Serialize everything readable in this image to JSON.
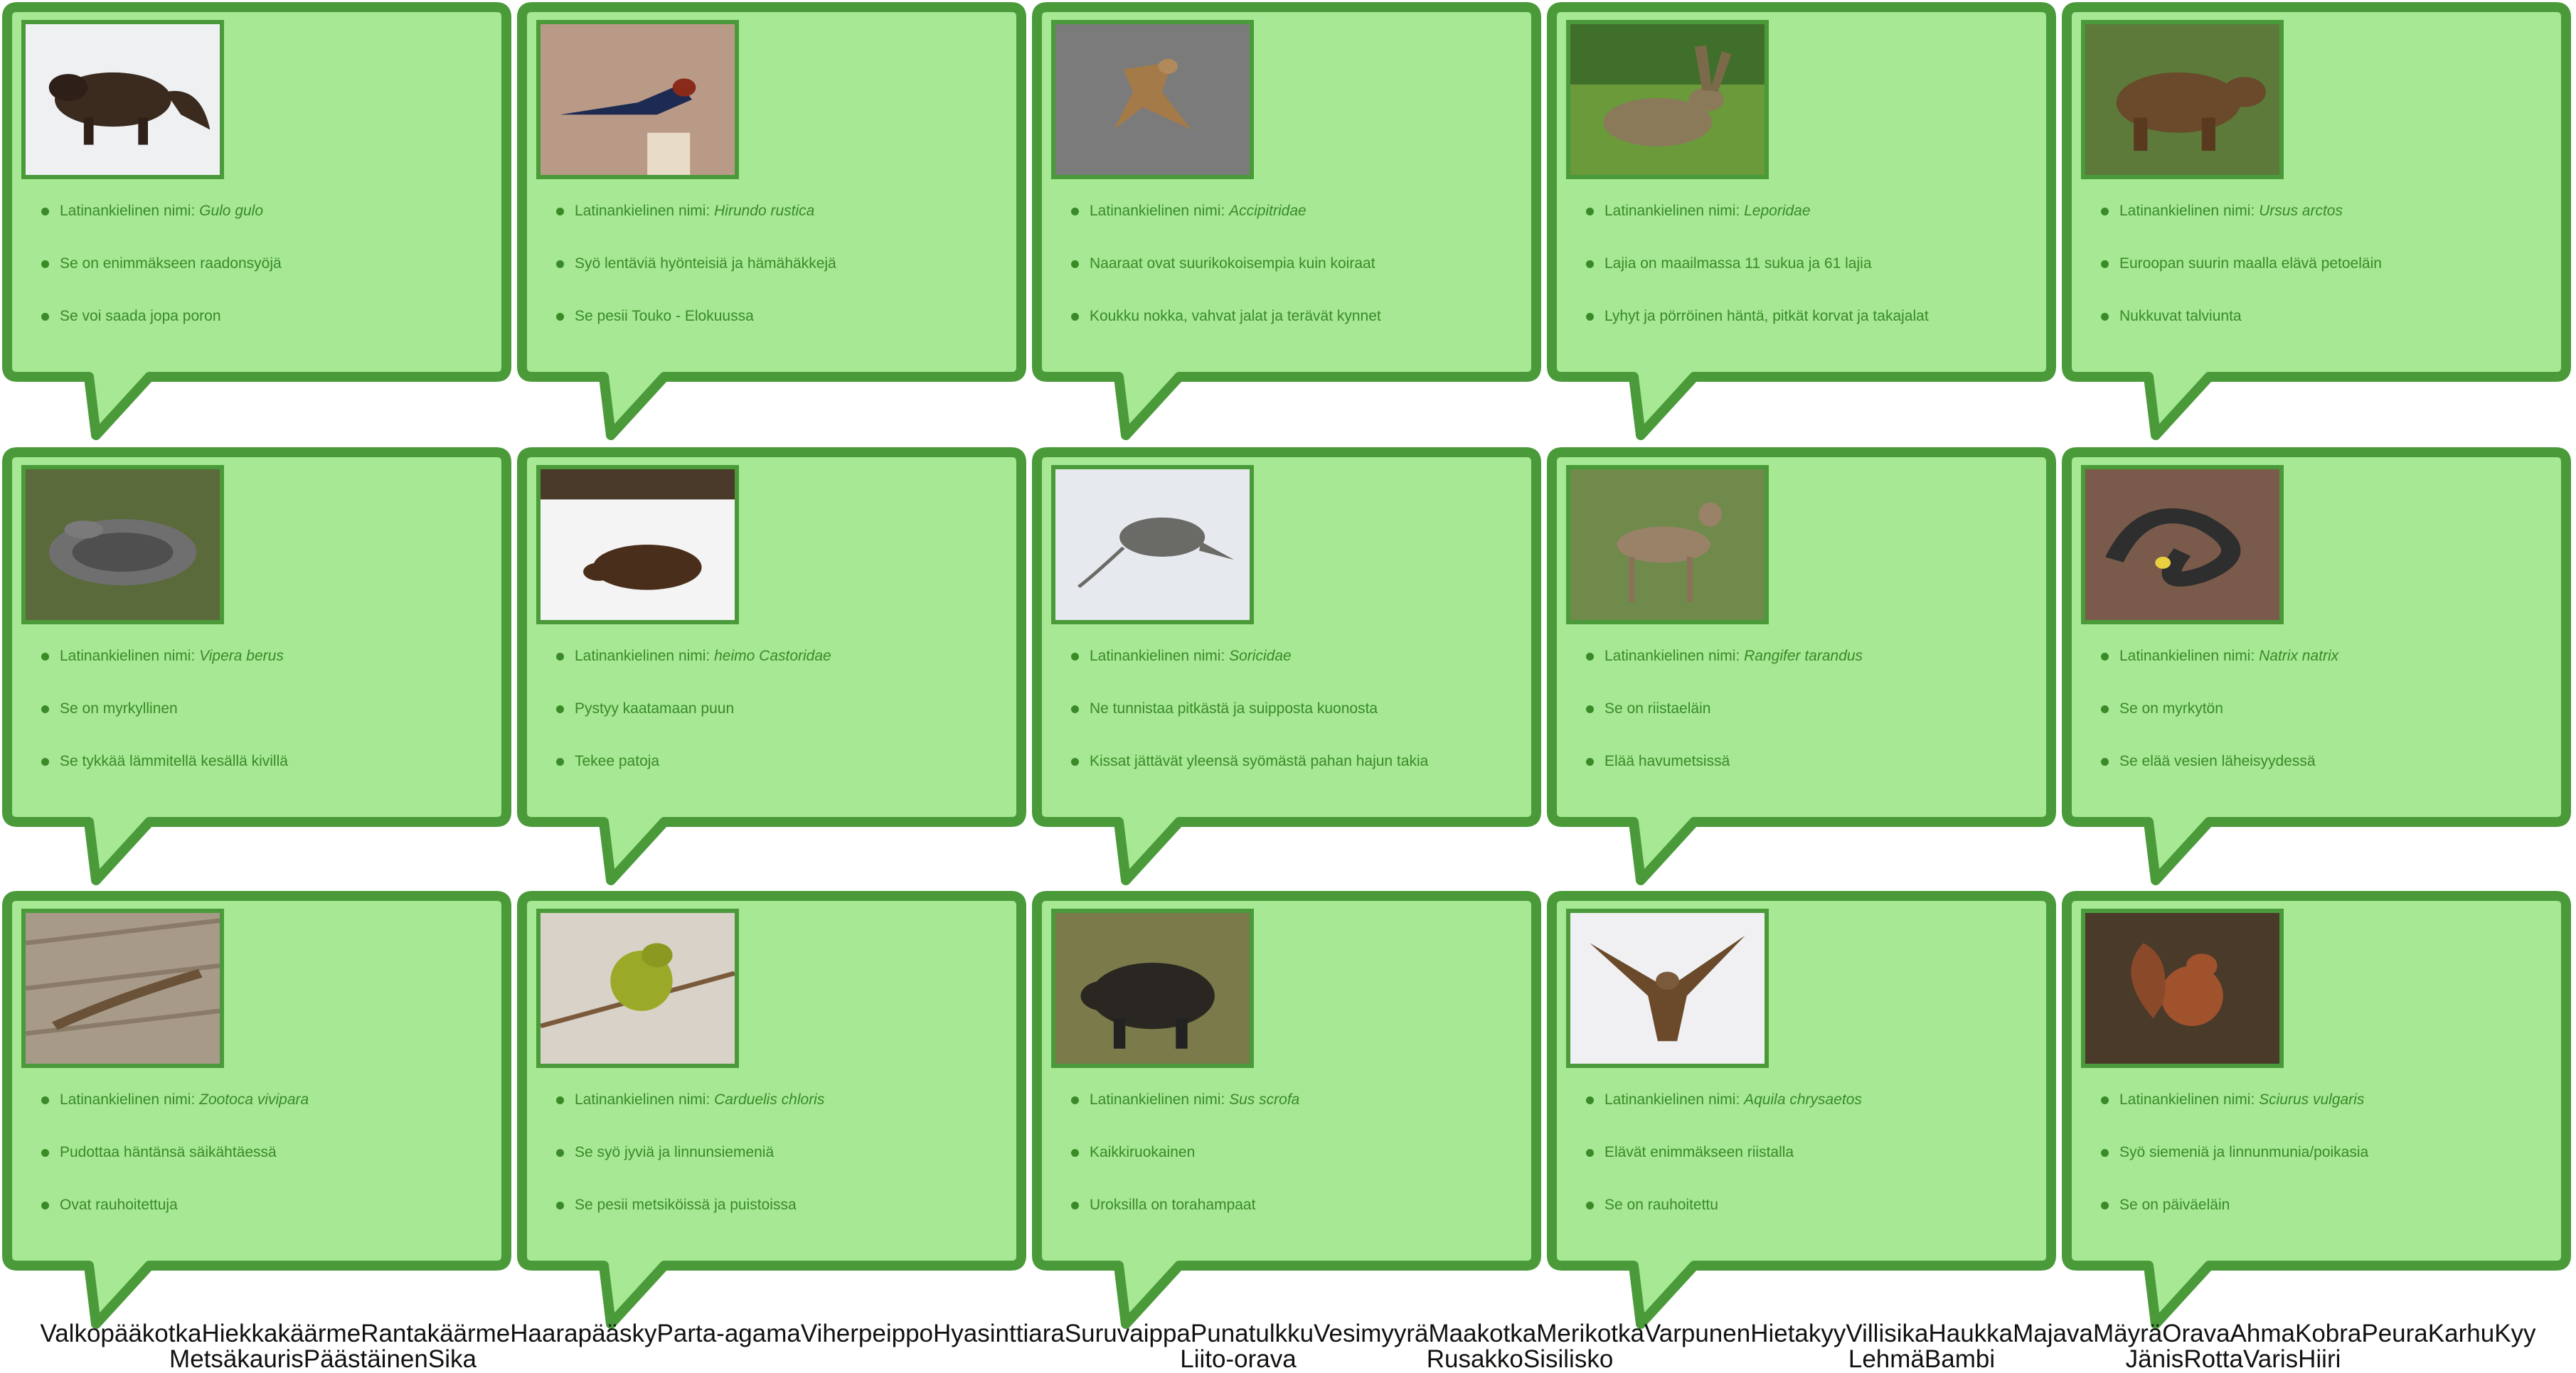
{
  "colors": {
    "bubble_fill": "#a6e893",
    "bubble_border": "#4a9a3a",
    "text": "#3a8a28"
  },
  "cards": [
    {
      "image": "wolverine-photo",
      "latin_prefix": "Latinankielinen nimi: ",
      "latin": "Gulo gulo",
      "fact2": "Se on enimmäkseen raadonsyöjä",
      "fact3": "Se voi saada jopa poron"
    },
    {
      "image": "swallow-photo",
      "latin_prefix": "Latinankielinen nimi: ",
      "latin": "Hirundo rustica",
      "fact2": "Syö lentäviä hyönteisiä ja hämähäkkejä",
      "fact3": "Se pesii Touko - Elokuussa"
    },
    {
      "image": "hawk-photo",
      "latin_prefix": "Latinankielinen nimi: ",
      "latin": "Accipitridae",
      "fact2": "Naaraat ovat suurikokoisempia kuin koiraat",
      "fact3": "Koukku nokka, vahvat jalat ja terävät kynnet"
    },
    {
      "image": "hare-photo",
      "latin_prefix": "Latinankielinen nimi: ",
      "latin": "Leporidae",
      "fact2": "Lajia on maailmassa 11 sukua ja 61 lajia",
      "fact3": "Lyhyt ja pörröinen häntä, pitkät korvat ja takajalat"
    },
    {
      "image": "bear-photo",
      "latin_prefix": "Latinankielinen nimi: ",
      "latin": "Ursus arctos",
      "fact2": "Euroopan suurin maalla elävä petoeläin",
      "fact3": "Nukkuvat talviunta"
    },
    {
      "image": "viper-photo",
      "latin_prefix": "Latinankielinen nimi: ",
      "latin": "Vipera berus",
      "fact2": "Se on myrkyllinen",
      "fact3": "Se tykkää lämmitellä kesällä kivillä"
    },
    {
      "image": "beaver-photo",
      "latin_prefix": "Latinankielinen nimi: ",
      "latin": "heimo Castoridae",
      "fact2": "Pystyy kaatamaan puun",
      "fact3": "Tekee patoja"
    },
    {
      "image": "shrew-photo",
      "latin_prefix": "Latinankielinen nimi: ",
      "latin": "Soricidae",
      "fact2": "Ne tunnistaa pitkästä ja suipposta kuonosta",
      "fact3": "Kissat jättävät yleensä syömästä pahan hajun takia"
    },
    {
      "image": "deer-photo",
      "latin_prefix": "Latinankielinen nimi: ",
      "latin": "Rangifer tarandus",
      "fact2": "Se on riistaeläin",
      "fact3": "Elää havumetsissä"
    },
    {
      "image": "grass-snake-photo",
      "latin_prefix": "Latinankielinen nimi: ",
      "latin": "Natrix natrix",
      "fact2": "Se on myrkytön",
      "fact3": "Se elää vesien läheisyydessä"
    },
    {
      "image": "lizard-photo",
      "latin_prefix": "Latinankielinen nimi: ",
      "latin": "Zootoca vivipara",
      "fact2": "Pudottaa häntänsä säikähtäessä",
      "fact3": "Ovat rauhoitettuja"
    },
    {
      "image": "greenfinch-photo",
      "latin_prefix": "Latinankielinen nimi: ",
      "latin": "Carduelis chloris",
      "fact2": "Se syö jyviä ja linnunsiemeniä",
      "fact3": "Se pesii metsiköissä ja puistoissa"
    },
    {
      "image": "boar-photo",
      "latin_prefix": "Latinankielinen nimi: ",
      "latin": "Sus scrofa",
      "fact2": "Kaikkiruokainen",
      "fact3": "Uroksilla on torahampaat"
    },
    {
      "image": "eagle-photo",
      "latin_prefix": "Latinankielinen nimi: ",
      "latin": "Aquila chrysaetos",
      "fact2": "Elävät enimmäkseen riistalla",
      "fact3": "Se on rauhoitettu"
    },
    {
      "image": "squirrel-photo",
      "latin_prefix": "Latinankielinen nimi: ",
      "latin": "Sciurus vulgaris",
      "fact2": "Syö siemeniä ja linnunmunia/poikasia",
      "fact3": "Se on päiväeläin"
    }
  ],
  "word_bank": {
    "row1": [
      "Valkopääkotka",
      "Hiekkakäärme",
      "Rantakäärme",
      "Haarapääsky",
      "Parta-agama",
      "Viherpeippo",
      "Hyasinttiara",
      "Suruvaippa",
      "Punatulkku",
      "Vesimyyrä",
      "Maakotka",
      "Merikotka",
      "Varpunen",
      "Hietakyy",
      "Villisika",
      "Haukka",
      "Majava",
      "Mäyrä",
      "Orava",
      "Ahma",
      "Kobra",
      "Peura",
      "Karhu",
      "Kyy"
    ],
    "row2_groups": [
      {
        "words": [
          "Metsäkauris",
          "Päästäinen",
          "Sika"
        ]
      },
      {
        "words": [
          "Liito-orava"
        ]
      },
      {
        "words": [
          "Rusakko",
          "Sisilisko"
        ]
      },
      {
        "words": [
          "Lehmä",
          "Bambi"
        ]
      },
      {
        "words": [
          "Jänis",
          "Rotta",
          "Varis",
          "Hiiri"
        ]
      }
    ]
  }
}
